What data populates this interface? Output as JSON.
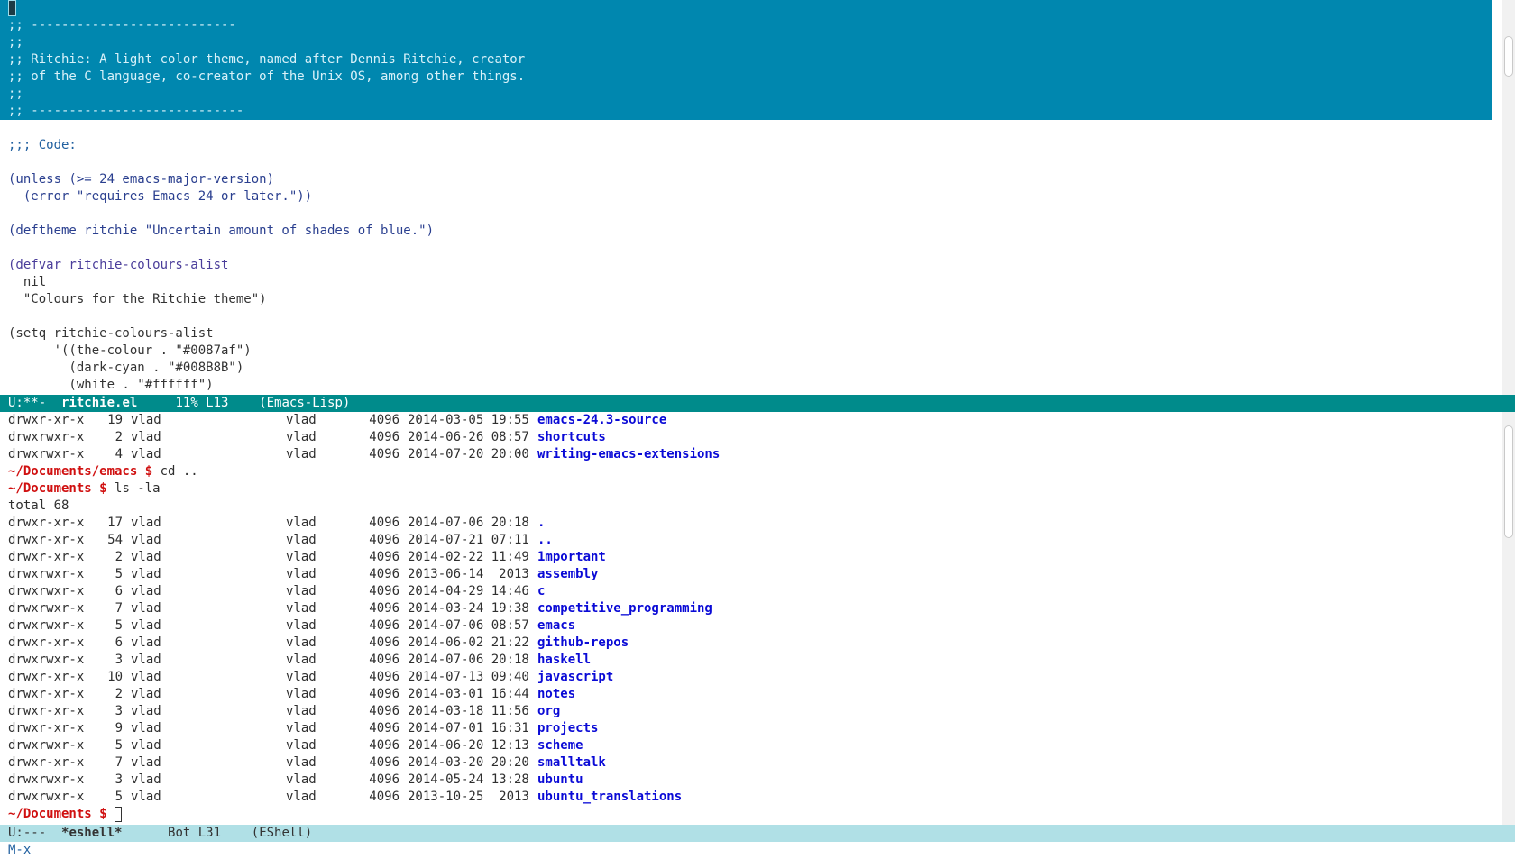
{
  "editor": {
    "highlighted_lines": [
      "",
      ";; ---------------------------",
      ";;",
      ";; Ritchie: A light color theme, named after Dennis Ritchie, creator",
      ";; of the C language, co-creator of the Unix OS, among other things.",
      ";;",
      ";; ----------------------------"
    ],
    "code_lines": [
      "",
      ";;; Code:",
      "",
      "(unless (>= 24 emacs-major-version)",
      "  (error \"requires Emacs 24 or later.\"))",
      "",
      "(deftheme ritchie \"Uncertain amount of shades of blue.\")",
      "",
      "(defvar ritchie-colours-alist",
      "  nil",
      "  \"Colours for the Ritchie theme\")",
      "",
      "(setq ritchie-colours-alist",
      "      '((the-colour . \"#0087af\")",
      "        (dark-cyan . \"#008B8B\")",
      "        (white . \"#ffffff\")"
    ]
  },
  "modeline_top": {
    "status": "U:**-",
    "buffer": "ritchie.el",
    "position": "11% L13",
    "mode": "(Emacs-Lisp)"
  },
  "eshell": {
    "pre_rows": [
      {
        "perm": "drwxr-xr-x",
        "links": "19",
        "owner": "vlad",
        "group": "vlad",
        "size": "4096",
        "date": "2014-03-05 19:55",
        "name": "emacs-24.3-source"
      },
      {
        "perm": "drwxrwxr-x",
        "links": "2",
        "owner": "vlad",
        "group": "vlad",
        "size": "4096",
        "date": "2014-06-26 08:57",
        "name": "shortcuts"
      },
      {
        "perm": "drwxrwxr-x",
        "links": "4",
        "owner": "vlad",
        "group": "vlad",
        "size": "4096",
        "date": "2014-07-20 20:00",
        "name": "writing-emacs-extensions"
      }
    ],
    "prompt1": "~/Documents/emacs $",
    "cmd1": "cd ..",
    "prompt2": "~/Documents $",
    "cmd2": "ls -la",
    "total": "total 68",
    "rows": [
      {
        "perm": "drwxr-xr-x",
        "links": "17",
        "owner": "vlad",
        "group": "vlad",
        "size": "4096",
        "date": "2014-07-06 20:18",
        "name": "."
      },
      {
        "perm": "drwxr-xr-x",
        "links": "54",
        "owner": "vlad",
        "group": "vlad",
        "size": "4096",
        "date": "2014-07-21 07:11",
        "name": ".."
      },
      {
        "perm": "drwxr-xr-x",
        "links": "2",
        "owner": "vlad",
        "group": "vlad",
        "size": "4096",
        "date": "2014-02-22 11:49",
        "name": "1mportant"
      },
      {
        "perm": "drwxrwxr-x",
        "links": "5",
        "owner": "vlad",
        "group": "vlad",
        "size": "4096",
        "date": "2013-06-14  2013",
        "name": "assembly"
      },
      {
        "perm": "drwxrwxr-x",
        "links": "6",
        "owner": "vlad",
        "group": "vlad",
        "size": "4096",
        "date": "2014-04-29 14:46",
        "name": "c"
      },
      {
        "perm": "drwxrwxr-x",
        "links": "7",
        "owner": "vlad",
        "group": "vlad",
        "size": "4096",
        "date": "2014-03-24 19:38",
        "name": "competitive_programming"
      },
      {
        "perm": "drwxrwxr-x",
        "links": "5",
        "owner": "vlad",
        "group": "vlad",
        "size": "4096",
        "date": "2014-07-06 08:57",
        "name": "emacs"
      },
      {
        "perm": "drwxr-xr-x",
        "links": "6",
        "owner": "vlad",
        "group": "vlad",
        "size": "4096",
        "date": "2014-06-02 21:22",
        "name": "github-repos"
      },
      {
        "perm": "drwxrwxr-x",
        "links": "3",
        "owner": "vlad",
        "group": "vlad",
        "size": "4096",
        "date": "2014-07-06 20:18",
        "name": "haskell"
      },
      {
        "perm": "drwxr-xr-x",
        "links": "10",
        "owner": "vlad",
        "group": "vlad",
        "size": "4096",
        "date": "2014-07-13 09:40",
        "name": "javascript"
      },
      {
        "perm": "drwxr-xr-x",
        "links": "2",
        "owner": "vlad",
        "group": "vlad",
        "size": "4096",
        "date": "2014-03-01 16:44",
        "name": "notes"
      },
      {
        "perm": "drwxr-xr-x",
        "links": "3",
        "owner": "vlad",
        "group": "vlad",
        "size": "4096",
        "date": "2014-03-18 11:56",
        "name": "org"
      },
      {
        "perm": "drwxr-xr-x",
        "links": "9",
        "owner": "vlad",
        "group": "vlad",
        "size": "4096",
        "date": "2014-07-01 16:31",
        "name": "projects"
      },
      {
        "perm": "drwxrwxr-x",
        "links": "5",
        "owner": "vlad",
        "group": "vlad",
        "size": "4096",
        "date": "2014-06-20 12:13",
        "name": "scheme"
      },
      {
        "perm": "drwxr-xr-x",
        "links": "7",
        "owner": "vlad",
        "group": "vlad",
        "size": "4096",
        "date": "2014-03-20 20:20",
        "name": "smalltalk"
      },
      {
        "perm": "drwxrwxr-x",
        "links": "3",
        "owner": "vlad",
        "group": "vlad",
        "size": "4096",
        "date": "2014-05-24 13:28",
        "name": "ubuntu"
      },
      {
        "perm": "drwxrwxr-x",
        "links": "5",
        "owner": "vlad",
        "group": "vlad",
        "size": "4096",
        "date": "2013-10-25  2013",
        "name": "ubuntu_translations"
      }
    ],
    "prompt3": "~/Documents $"
  },
  "modeline_bottom": {
    "status": "U:---",
    "buffer": "*eshell*",
    "position": "Bot L31",
    "mode": "(EShell)"
  },
  "minibuffer": {
    "text": "M-x"
  },
  "colors": {
    "highlight_bg": "#0087af",
    "modeline_active_bg": "#008b8b",
    "modeline_inactive_bg": "#b0e0e6",
    "directory": "#0a0ad6",
    "prompt": "#d01010"
  }
}
